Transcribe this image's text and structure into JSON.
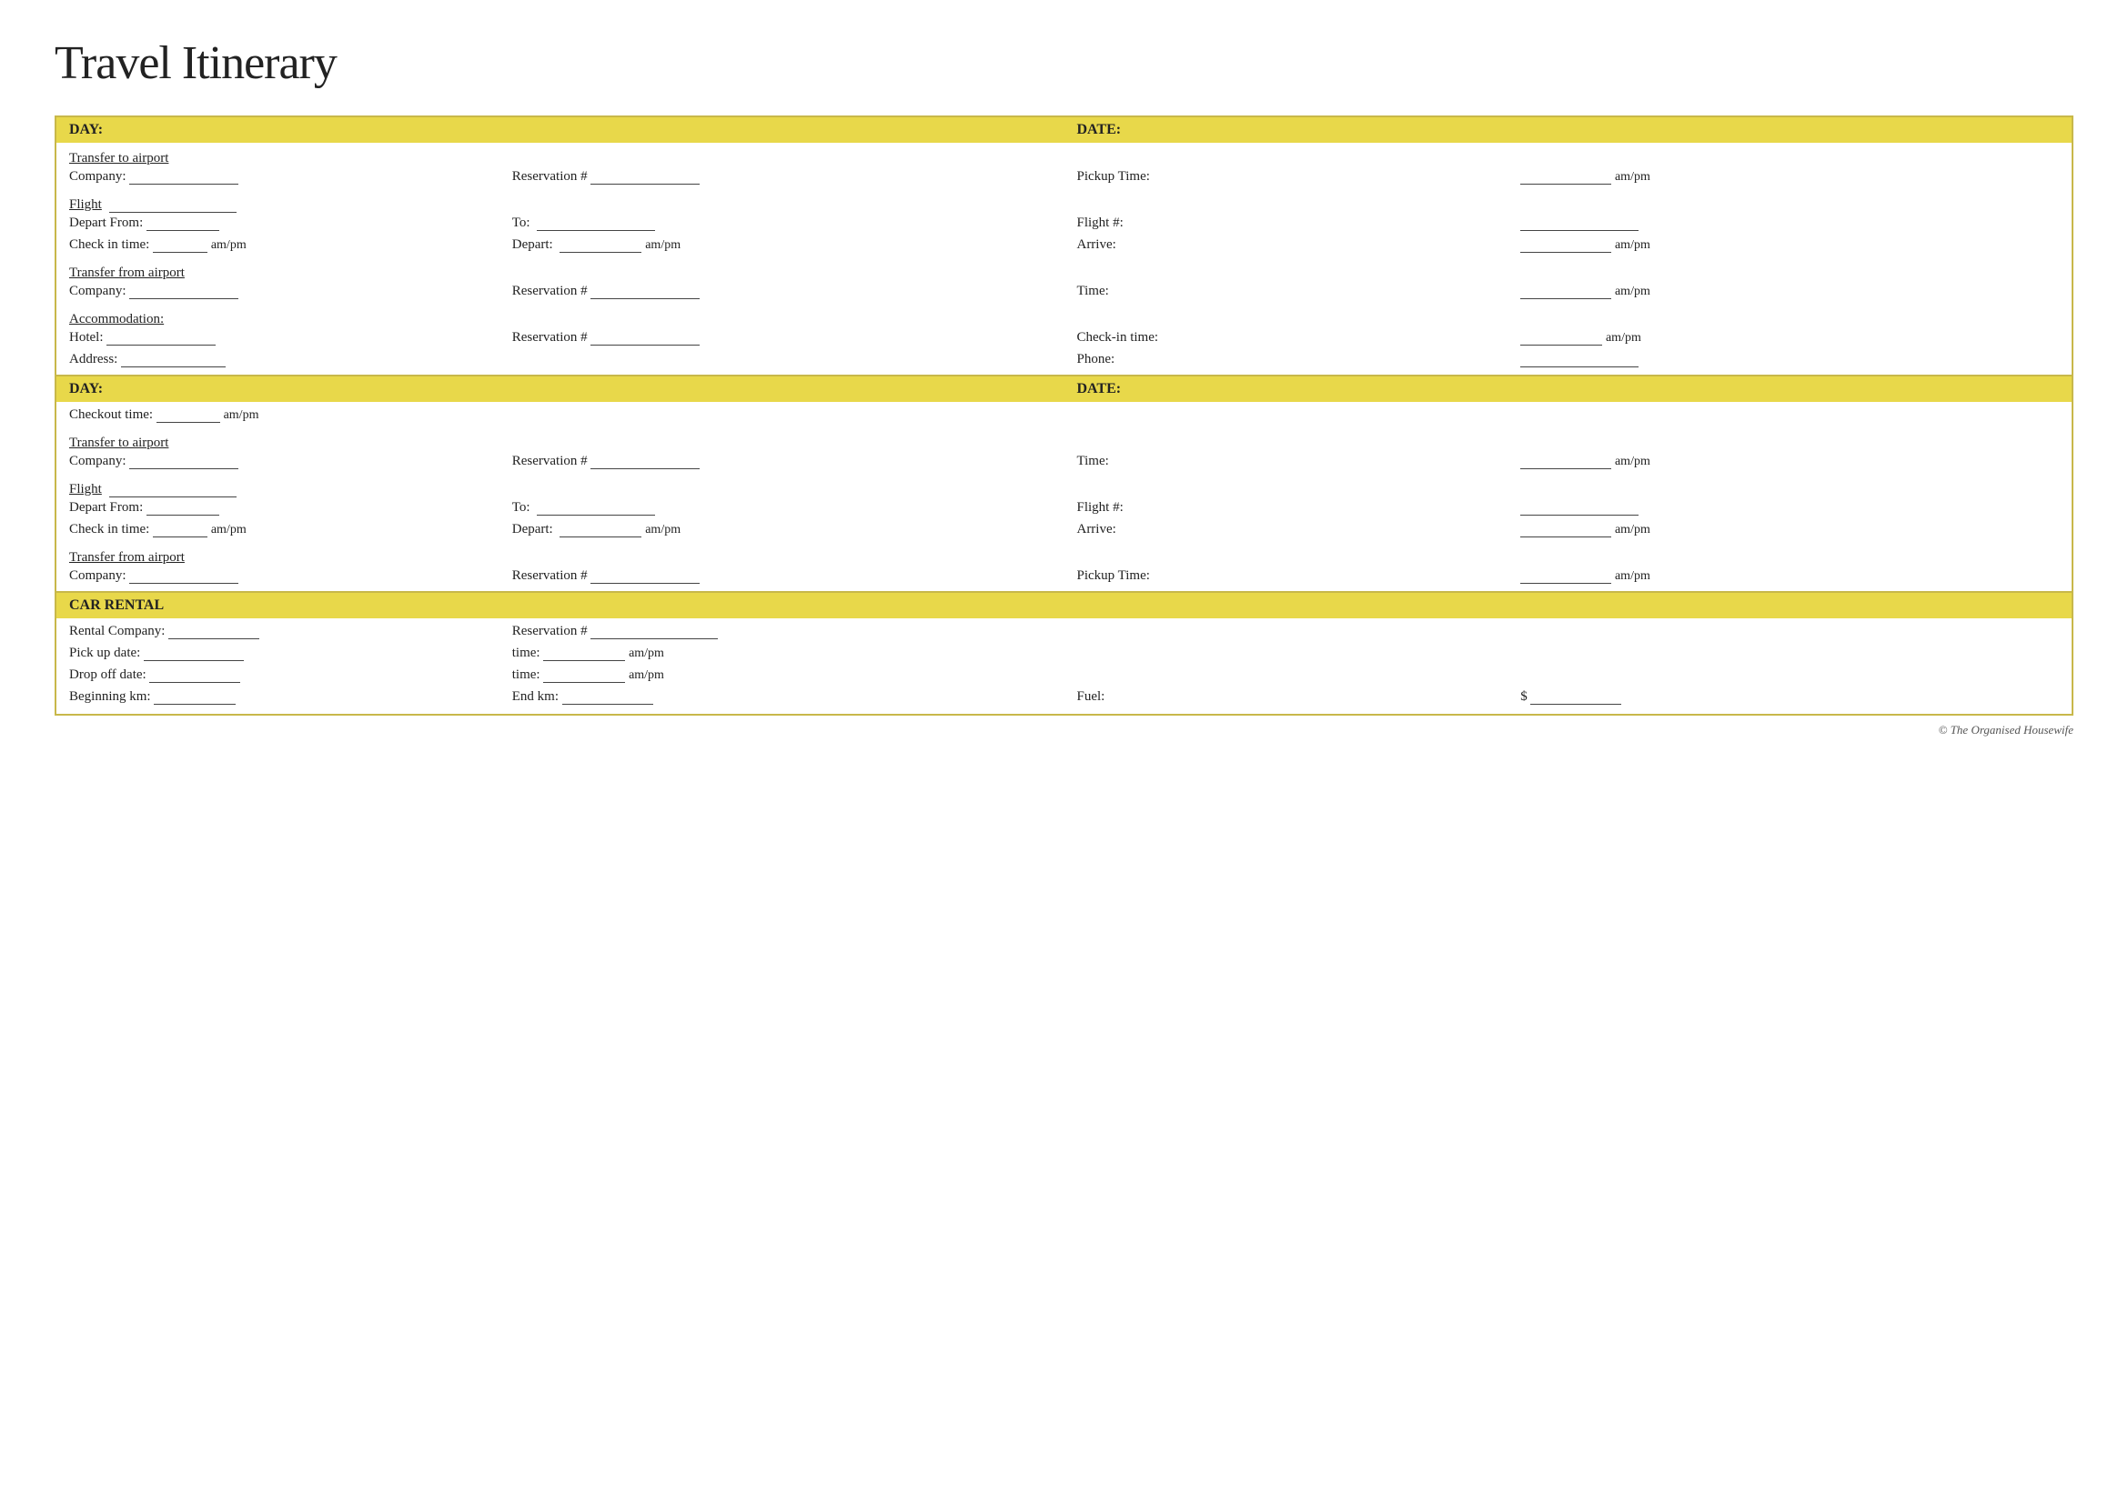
{
  "title": "Travel Itinerary",
  "sections": [
    {
      "type": "day-header",
      "day_label": "DAY:",
      "date_label": "DATE:"
    },
    {
      "type": "section",
      "rows": [
        {
          "label": "Transfer to airport",
          "underline": true
        },
        {
          "label": "Company:",
          "col2_label": "Reservation #",
          "col3_label": "Pickup Time:",
          "col3_suffix": "am/pm"
        },
        {
          "label": "Flight",
          "underline": true
        },
        {
          "label": "Depart From:",
          "col2_label": "To:",
          "col3_label": "Flight #:"
        },
        {
          "label": "Check in time:",
          "col1_suffix": "am/pm",
          "col2_label": "Depart:",
          "col2_suffix": "am/pm",
          "col3_label": "Arrive:",
          "col3_suffix": "am/pm"
        },
        {
          "label": "Transfer from airport",
          "underline": true
        },
        {
          "label": "Company:",
          "col2_label": "Reservation #",
          "col3_label": "Time:",
          "col3_suffix": "am/pm"
        },
        {
          "label": "Accommodation:",
          "underline": true
        },
        {
          "label": "Hotel:",
          "col2_label": "Reservation #",
          "col3_label": "Check-in time:",
          "col3_suffix": "am/pm"
        },
        {
          "label": "Address:",
          "col3_label": "Phone:"
        }
      ]
    },
    {
      "type": "day-header",
      "day_label": "DAY:",
      "date_label": "DATE:"
    },
    {
      "type": "section",
      "rows": [
        {
          "label": "Checkout time:",
          "col1_suffix": "am/pm"
        },
        {
          "label": "Transfer to airport",
          "underline": true
        },
        {
          "label": "Company:",
          "col2_label": "Reservation #",
          "col3_label": "Time:",
          "col3_suffix": "am/pm"
        },
        {
          "label": "Flight",
          "underline": true
        },
        {
          "label": "Depart From:",
          "col2_label": "To:",
          "col3_label": "Flight #:"
        },
        {
          "label": "Check in time:",
          "col1_suffix": "am/pm",
          "col2_label": "Depart:",
          "col2_suffix": "am/pm",
          "col3_label": "Arrive:",
          "col3_suffix": "am/pm"
        },
        {
          "label": "Transfer from airport",
          "underline": true
        },
        {
          "label": "Company:",
          "col2_label": "Reservation #",
          "col3_label": "Pickup Time:",
          "col3_suffix": "am/pm"
        }
      ]
    },
    {
      "type": "day-header",
      "day_label": "CAR RENTAL",
      "date_label": ""
    },
    {
      "type": "section",
      "rows": [
        {
          "label": "Rental Company:",
          "col2_label": "Reservation #"
        },
        {
          "label": "Pick up date:",
          "col2_label": "time:",
          "col2_suffix": "am/pm"
        },
        {
          "label": "Drop off date:",
          "col2_label": "time:",
          "col2_suffix": "am/pm"
        },
        {
          "label": "Beginning km:",
          "col2_label": "End km:",
          "col3_label": "Fuel:",
          "col3_suffix": "$"
        }
      ]
    }
  ],
  "copyright": "© The Organised Housewife"
}
